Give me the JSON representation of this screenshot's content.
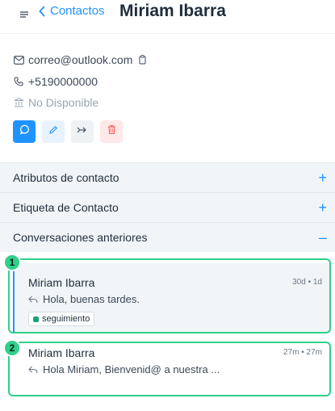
{
  "header": {
    "back_label": "Contactos",
    "title": "Miriam Ibarra"
  },
  "contact": {
    "email": "correo@outlook.com",
    "phone": "+5190000000",
    "company": "No Disponible"
  },
  "actions": {
    "icons": [
      "chat-icon",
      "pencil-icon",
      "merge-icon",
      "trash-icon"
    ]
  },
  "sections": [
    {
      "label": "Atributos de contacto",
      "sign": "+"
    },
    {
      "label": "Etiqueta de Contacto",
      "sign": "+"
    },
    {
      "label": "Conversaciones anteriores",
      "sign": "–"
    }
  ],
  "conversations": [
    {
      "marker": "1",
      "name": "Miriam Ibarra",
      "time": "30d • 1d",
      "message": "Hola, buenas tardes.",
      "label": "seguimiento"
    },
    {
      "marker": "2",
      "name": "Miriam Ibarra",
      "time": "27m • 27m",
      "message": "Hola Miriam, Bienvenid@ a nuestra ..."
    }
  ],
  "colors": {
    "accent": "#1f93ff",
    "highlight": "#2fd08a",
    "label_dot": "#1aa37a",
    "danger": "#ff5a5a"
  }
}
